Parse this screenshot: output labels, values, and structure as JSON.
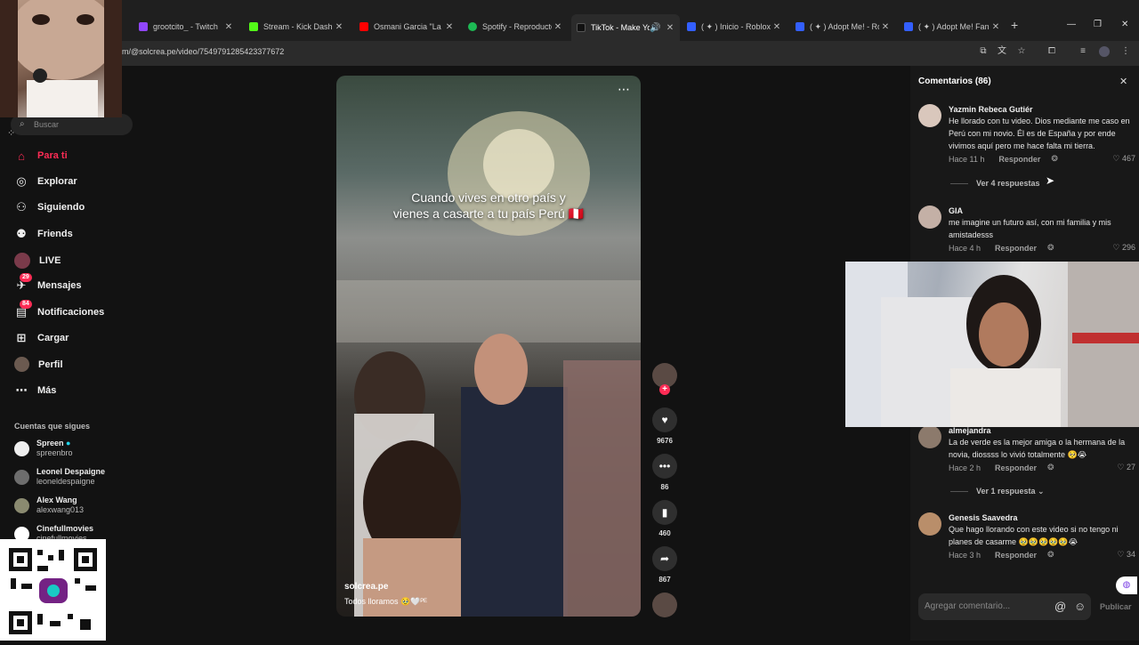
{
  "browser": {
    "tabs": [
      {
        "title": "grootcito_ - Twitch",
        "color": "#9146ff"
      },
      {
        "title": "Stream - Kick Dashbo",
        "color": "#53fc18"
      },
      {
        "title": "Osmani Garcia \"La Vo",
        "color": "#ff0000"
      },
      {
        "title": "Spotify - Reproductor",
        "color": "#1db954"
      },
      {
        "title": "TikTok - Make Yo",
        "color": "#111111"
      },
      {
        "title": "( ✦ ) Inicio - Roblox",
        "color": "#335fff"
      },
      {
        "title": "( ✦ ) Adopt Me! - Rob",
        "color": "#335fff"
      },
      {
        "title": "( ✦ ) Adopt Me! Fan c",
        "color": "#335fff"
      }
    ],
    "url": "m/@solcrea.pe/video/7549791285423377672"
  },
  "sidebar": {
    "search_placeholder": "Buscar",
    "nav": [
      {
        "label": "Para ti",
        "icon": "home-icon"
      },
      {
        "label": "Explorar",
        "icon": "compass-icon"
      },
      {
        "label": "Siguiendo",
        "icon": "following-icon"
      },
      {
        "label": "Friends",
        "icon": "friends-icon"
      },
      {
        "label": "LIVE",
        "icon": "live-icon"
      },
      {
        "label": "Mensajes",
        "icon": "messages-icon",
        "badge": "29"
      },
      {
        "label": "Notificaciones",
        "icon": "notifications-icon",
        "badge": "84"
      },
      {
        "label": "Cargar",
        "icon": "upload-icon"
      },
      {
        "label": "Perfil",
        "icon": "profile-icon"
      },
      {
        "label": "Más",
        "icon": "more-icon"
      }
    ],
    "following_title": "Cuentas que sigues",
    "following": [
      {
        "name": "Spreen",
        "handle": "spreenbro"
      },
      {
        "name": "Leonel Despaigne",
        "handle": "leoneldespaigne"
      },
      {
        "name": "Alex Wang",
        "handle": "alexwang013"
      },
      {
        "name": "Cinefullmovies",
        "handle": "cinefullmovies"
      }
    ]
  },
  "video": {
    "caption_line1": "Cuando vives en otro país y",
    "caption_line2": "vienes a casarte a tu país Perú 🇵🇪",
    "username": "solcrea.pe",
    "description": "Todos lloramos 🥹🤍ᴾᴱ"
  },
  "actions": {
    "likes": "9676",
    "comments": "86",
    "saves": "460",
    "shares": "867"
  },
  "comments_panel": {
    "title": "Comentarios (86)",
    "input_placeholder": "Agregar comentario...",
    "publish_label": "Publicar",
    "reply_label": "Responder",
    "items": [
      {
        "name": "Yazmin Rebeca Gutiér",
        "text": "He llorado con tu video. Dios mediante me caso en Perú con mi novio. Él es de España y por ende vivimos aquí pero me hace falta mi tierra.",
        "time": "Hace 11 h",
        "likes": "467",
        "replies": "Ver 4 respuestas"
      },
      {
        "name": "GIA",
        "text": "me imagine un futuro así, con mi familia y mis amistadesss",
        "time": "Hace 4 h",
        "likes": "296"
      },
      {
        "name": "almejandra",
        "text": "La de verde es la mejor amiga o la hermana de la novia, diossss lo vivió totalmente 🥺😭",
        "time": "Hace 2 h",
        "likes": "27",
        "replies": "Ver 1 respuesta ⌄"
      },
      {
        "name": "Genesis Saavedra",
        "text": "Que hago llorando con este video si no tengo ni planes de casarme 🥹🥹🥹🥹🥹😭",
        "time": "Hace 3 h",
        "likes": "34"
      }
    ]
  }
}
